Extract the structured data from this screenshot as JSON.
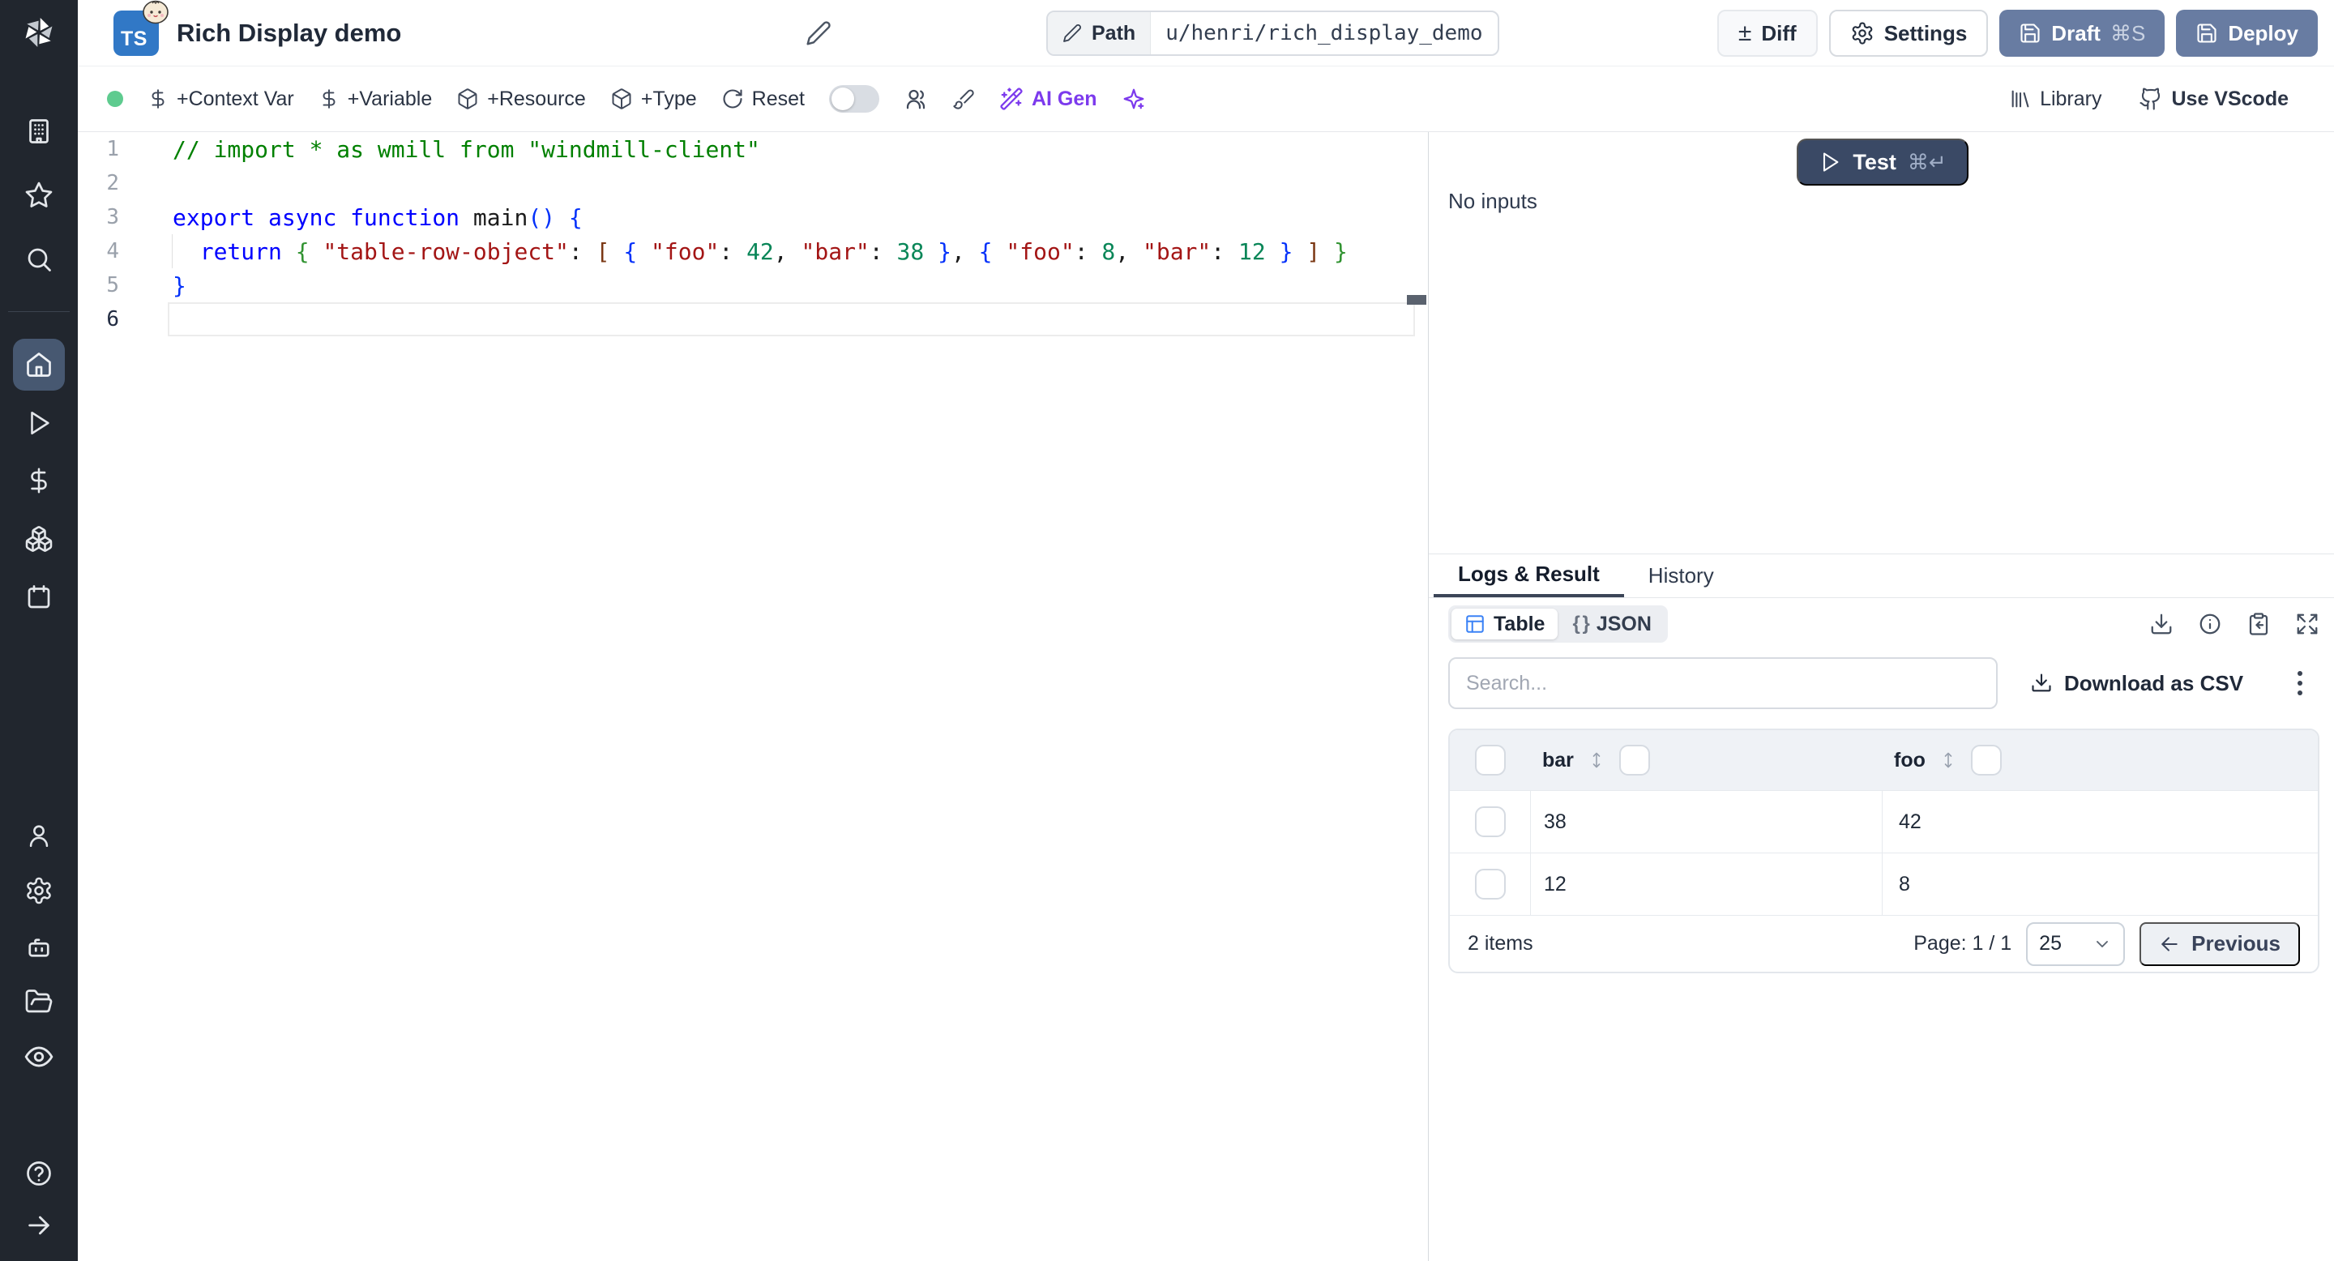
{
  "header": {
    "badge": "TS",
    "title": "Rich Display demo",
    "path_label": "Path",
    "path_value": "u/henri/rich_display_demo",
    "diff_icon": "±",
    "diff_label": "Diff",
    "settings_label": "Settings",
    "draft_label": "Draft",
    "draft_shortcut": "⌘S",
    "deploy_label": "Deploy"
  },
  "toolbar": {
    "context_var": "+Context Var",
    "variable": "+Variable",
    "resource": "+Resource",
    "type": "+Type",
    "reset": "Reset",
    "ai_gen": "AI Gen",
    "library": "Library",
    "use_vscode": "Use VScode"
  },
  "sidebar": {
    "icons": [
      "windmill-logo",
      "building",
      "star",
      "search",
      "home",
      "play",
      "dollar",
      "boxes",
      "calendar",
      "user",
      "gear",
      "robot",
      "folder-open",
      "eye",
      "help",
      "arrow-right"
    ],
    "active": "home"
  },
  "editor": {
    "lines": [
      {
        "num": "1",
        "tokens": [
          {
            "t": "// import * as wmill from \"windmill-client\"",
            "c": "cm"
          }
        ]
      },
      {
        "num": "2",
        "tokens": []
      },
      {
        "num": "3",
        "tokens": [
          {
            "t": "export",
            "c": "kw"
          },
          {
            "t": " ",
            "c": "pl"
          },
          {
            "t": "async",
            "c": "kw"
          },
          {
            "t": " ",
            "c": "pl"
          },
          {
            "t": "function",
            "c": "kw"
          },
          {
            "t": " main",
            "c": "pl"
          },
          {
            "t": "(",
            "c": "b1"
          },
          {
            "t": ")",
            "c": "b1"
          },
          {
            "t": " ",
            "c": "pl"
          },
          {
            "t": "{",
            "c": "b1"
          }
        ]
      },
      {
        "num": "4",
        "tokens": [
          {
            "t": "  ",
            "c": "pl"
          },
          {
            "t": "return",
            "c": "kw"
          },
          {
            "t": " ",
            "c": "pl"
          },
          {
            "t": "{",
            "c": "b2"
          },
          {
            "t": " ",
            "c": "pl"
          },
          {
            "t": "\"table-row-object\"",
            "c": "st"
          },
          {
            "t": ": ",
            "c": "pl"
          },
          {
            "t": "[",
            "c": "b3"
          },
          {
            "t": " ",
            "c": "pl"
          },
          {
            "t": "{",
            "c": "b1"
          },
          {
            "t": " ",
            "c": "pl"
          },
          {
            "t": "\"foo\"",
            "c": "st"
          },
          {
            "t": ": ",
            "c": "pl"
          },
          {
            "t": "42",
            "c": "nu"
          },
          {
            "t": ", ",
            "c": "pl"
          },
          {
            "t": "\"bar\"",
            "c": "st"
          },
          {
            "t": ": ",
            "c": "pl"
          },
          {
            "t": "38",
            "c": "nu"
          },
          {
            "t": " ",
            "c": "pl"
          },
          {
            "t": "}",
            "c": "b1"
          },
          {
            "t": ", ",
            "c": "pl"
          },
          {
            "t": "{",
            "c": "b1"
          },
          {
            "t": " ",
            "c": "pl"
          },
          {
            "t": "\"foo\"",
            "c": "st"
          },
          {
            "t": ": ",
            "c": "pl"
          },
          {
            "t": "8",
            "c": "nu"
          },
          {
            "t": ", ",
            "c": "pl"
          },
          {
            "t": "\"bar\"",
            "c": "st"
          },
          {
            "t": ": ",
            "c": "pl"
          },
          {
            "t": "12",
            "c": "nu"
          },
          {
            "t": " ",
            "c": "pl"
          },
          {
            "t": "}",
            "c": "b1"
          },
          {
            "t": " ",
            "c": "pl"
          },
          {
            "t": "]",
            "c": "b3"
          },
          {
            "t": " ",
            "c": "pl"
          },
          {
            "t": "}",
            "c": "b2"
          }
        ]
      },
      {
        "num": "5",
        "tokens": [
          {
            "t": "}",
            "c": "b1"
          }
        ]
      },
      {
        "num": "6",
        "tokens": [],
        "current": true
      }
    ]
  },
  "run_panel": {
    "test_label": "Test",
    "test_shortcut": "⌘↵",
    "no_inputs": "No inputs",
    "tabs": [
      {
        "label": "Logs & Result",
        "active": true
      },
      {
        "label": "History",
        "active": false
      }
    ]
  },
  "result_panel": {
    "view_toggle": {
      "table": "Table",
      "json": "JSON",
      "json_icon": "{ }"
    },
    "search_placeholder": "Search...",
    "download_csv": "Download as CSV",
    "table": {
      "columns": [
        "bar",
        "foo"
      ],
      "rows": [
        [
          "38",
          "42"
        ],
        [
          "12",
          "8"
        ]
      ]
    },
    "footer": {
      "count": "2 items",
      "page": "Page: 1 / 1",
      "page_size": "25",
      "previous": "Previous"
    }
  },
  "colors": {
    "sidebar_bg": "#21262e",
    "sidebar_active": "#475871",
    "accent_slate": "#687ca2",
    "test_button": "#3a4965",
    "ai_purple": "#7c3aed",
    "ts_blue": "#3178c6",
    "status_green": "#5ecb8f"
  }
}
